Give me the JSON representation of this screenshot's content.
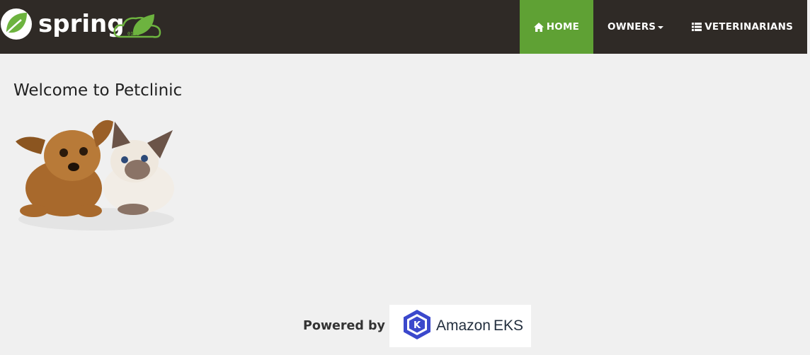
{
  "brand": {
    "name": "spring",
    "cloud_label": "0101"
  },
  "nav": {
    "items": [
      {
        "label": "HOME",
        "icon": "home-icon",
        "active": true
      },
      {
        "label": "OWNERS",
        "icon": "caret-down-icon",
        "active": false
      },
      {
        "label": "VETERINARIANS",
        "icon": "list-icon",
        "active": false
      }
    ]
  },
  "main": {
    "title": "Welcome to Petclinic",
    "image": "dog-and-cat-illustration"
  },
  "footer": {
    "powered_by": "Powered by",
    "platform": {
      "word1": "Amazon",
      "word2": "EKS",
      "icon": "kubernetes-k-hexagon-icon"
    }
  },
  "colors": {
    "navbar": "#2f2a26",
    "active": "#5fa134",
    "spring_green": "#6db33f",
    "page_bg": "#f0f0f0",
    "eks_blue": "#3b48cc"
  }
}
